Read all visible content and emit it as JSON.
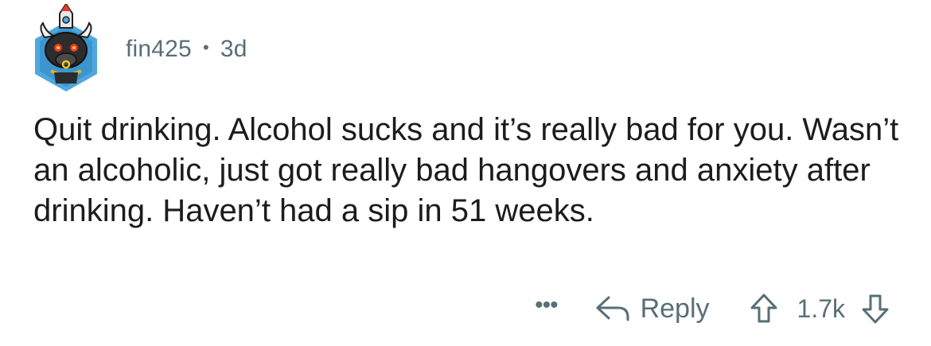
{
  "comment": {
    "author": "fin425",
    "separator": "•",
    "age": "3d",
    "avatar_icon": "snoo-bull-rocket-avatar",
    "text": "Quit drinking. Alcohol sucks and it’s really bad for you. Wasn’t an alcoholic, just got really bad hangovers and anxiety after drinking. Haven’t had a sip in 51 weeks.",
    "actions": {
      "more_label": "•••",
      "reply_label": "Reply",
      "score": "1.7k"
    }
  },
  "colors": {
    "text": "#1c1c1c",
    "meta": "#576f76",
    "avatar_bg": "#3a9bd6"
  }
}
